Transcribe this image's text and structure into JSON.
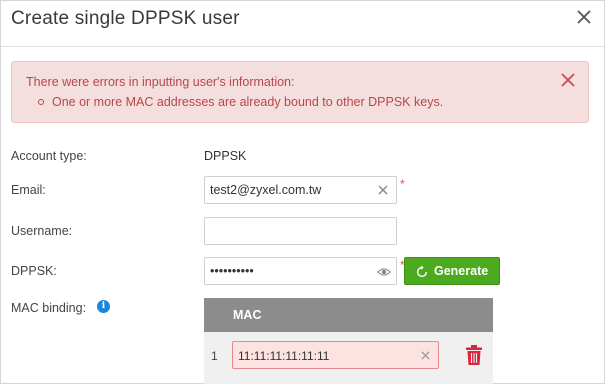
{
  "dialog": {
    "title": "Create single DPPSK user"
  },
  "alert": {
    "title": "There were errors in inputting user's information:",
    "items": [
      "One or more MAC addresses are already bound to other DPPSK keys."
    ]
  },
  "form": {
    "account_type": {
      "label": "Account type:",
      "value": "DPPSK"
    },
    "email": {
      "label": "Email:",
      "value": "test2@zyxel.com.tw",
      "required_mark": "*"
    },
    "username": {
      "label": "Username:",
      "value": ""
    },
    "dppsk": {
      "label": "DPPSK:",
      "value": "••••••••••",
      "required_mark": "*",
      "generate_label": "Generate"
    },
    "mac_binding": {
      "label": "MAC binding:",
      "column_header": "MAC",
      "rows": [
        {
          "num": "1",
          "mac": "11:11:11:11:11:11"
        }
      ]
    }
  },
  "icons": {
    "close": "close-icon",
    "alert_close": "close-icon",
    "clear": "clear-icon",
    "eye": "eye-icon",
    "refresh": "refresh-icon",
    "info": "info-icon",
    "trash": "trash-icon"
  },
  "colors": {
    "alert_bg": "#f5dede",
    "alert_text": "#b7474a",
    "generate_button": "#4caa1e",
    "required": "#d9534f",
    "info": "#1c87d8",
    "trash": "#d7263d",
    "mac_error_bg": "#fde2e2",
    "table_header": "#8c8c8c"
  }
}
